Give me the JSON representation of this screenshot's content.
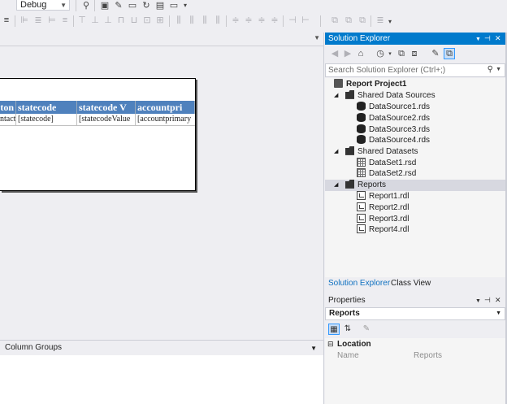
{
  "toolbar": {
    "configuration": "Debug"
  },
  "group_pane": {
    "label": "Column Groups"
  },
  "report": {
    "headers": [
      "ton",
      "statecode",
      "statecode V",
      "accountpri"
    ],
    "row": [
      "ntact",
      "[statecode]",
      "[statecodeValue",
      "[accountprimary"
    ]
  },
  "solution_explorer": {
    "title": "Solution Explorer",
    "search_placeholder": "Search Solution Explorer (Ctrl+;)",
    "project": "Report Project1",
    "shared_data_sources": {
      "label": "Shared Data Sources",
      "items": [
        "DataSource1.rds",
        "DataSource2.rds",
        "DataSource3.rds",
        "DataSource4.rds"
      ]
    },
    "shared_datasets": {
      "label": "Shared Datasets",
      "items": [
        "DataSet1.rsd",
        "DataSet2.rsd"
      ]
    },
    "reports": {
      "label": "Reports",
      "items": [
        "Report1.rdl",
        "Report2.rdl",
        "Report3.rdl",
        "Report4.rdl"
      ]
    },
    "tabs": [
      "Solution Explorer",
      "Class View"
    ]
  },
  "properties": {
    "title": "Properties",
    "object": "Reports",
    "category": "Location",
    "row": {
      "name": "Name",
      "value": "Reports"
    }
  },
  "colors": {
    "accent": "#007acc",
    "table_header": "#4f81bd",
    "selection": "#d7d8e0"
  }
}
